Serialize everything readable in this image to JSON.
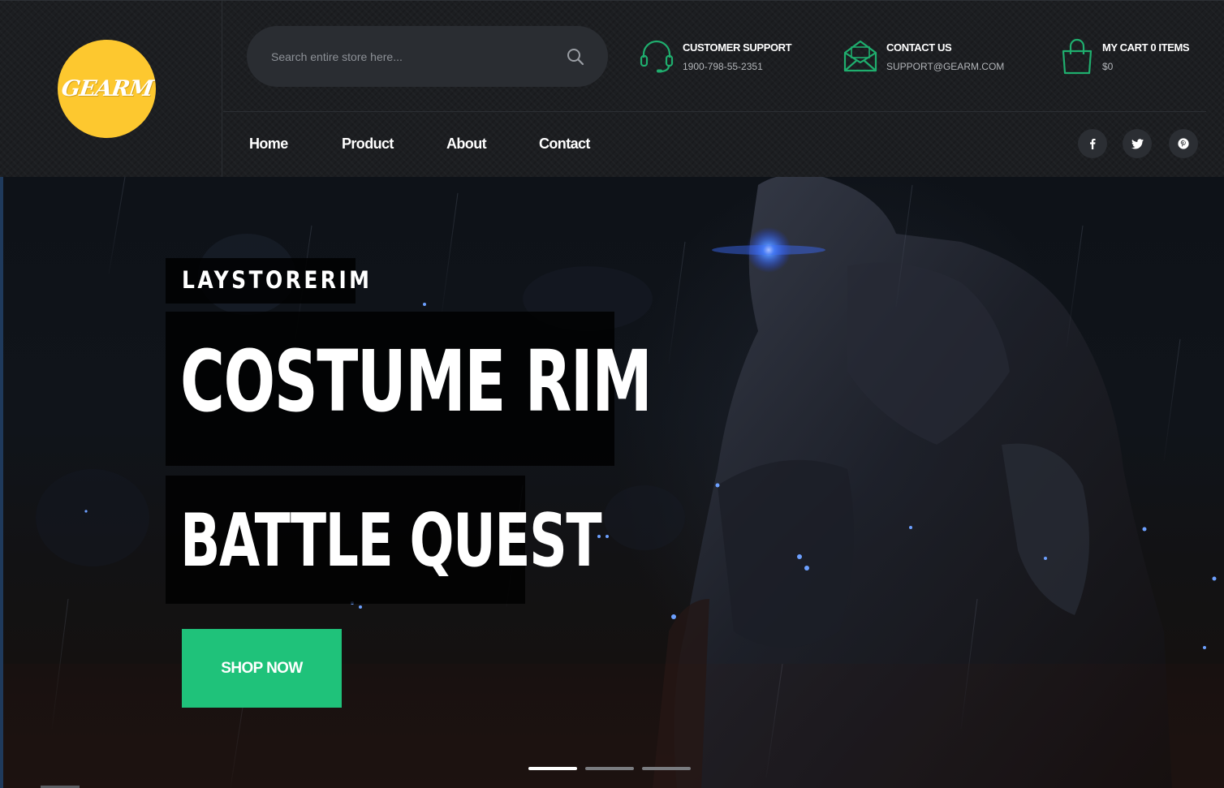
{
  "brand": {
    "logo_text": "GEARM",
    "logo_color": "#fdc82f"
  },
  "search": {
    "placeholder": "Search entire store here..."
  },
  "header_info": {
    "support": {
      "title": "CUSTOMER SUPPORT",
      "value": "1900-798-55-2351",
      "icon": "headset-icon"
    },
    "contact": {
      "title": "CONTACT US",
      "value": "SUPPORT@GEARM.COM",
      "icon": "envelope-icon"
    },
    "cart": {
      "title": "MY CART 0 ITEMS",
      "value": "$0",
      "icon": "shopping-bag-icon"
    }
  },
  "nav": [
    {
      "label": "Home"
    },
    {
      "label": "Product"
    },
    {
      "label": "About"
    },
    {
      "label": "Contact"
    }
  ],
  "social": [
    {
      "icon": "facebook-icon"
    },
    {
      "icon": "twitter-icon"
    },
    {
      "icon": "pinterest-icon"
    }
  ],
  "hero": {
    "tag": "LAYSTORERIM",
    "title": "COSTUME RIM",
    "subtitle": "BATTLE QUEST",
    "cta": "SHOP NOW",
    "slides_total": 3,
    "active_slide": 1
  },
  "colors": {
    "accent_green": "#1fc27a",
    "icon_green": "#1fae6e",
    "header_bg": "#1c1e21"
  }
}
